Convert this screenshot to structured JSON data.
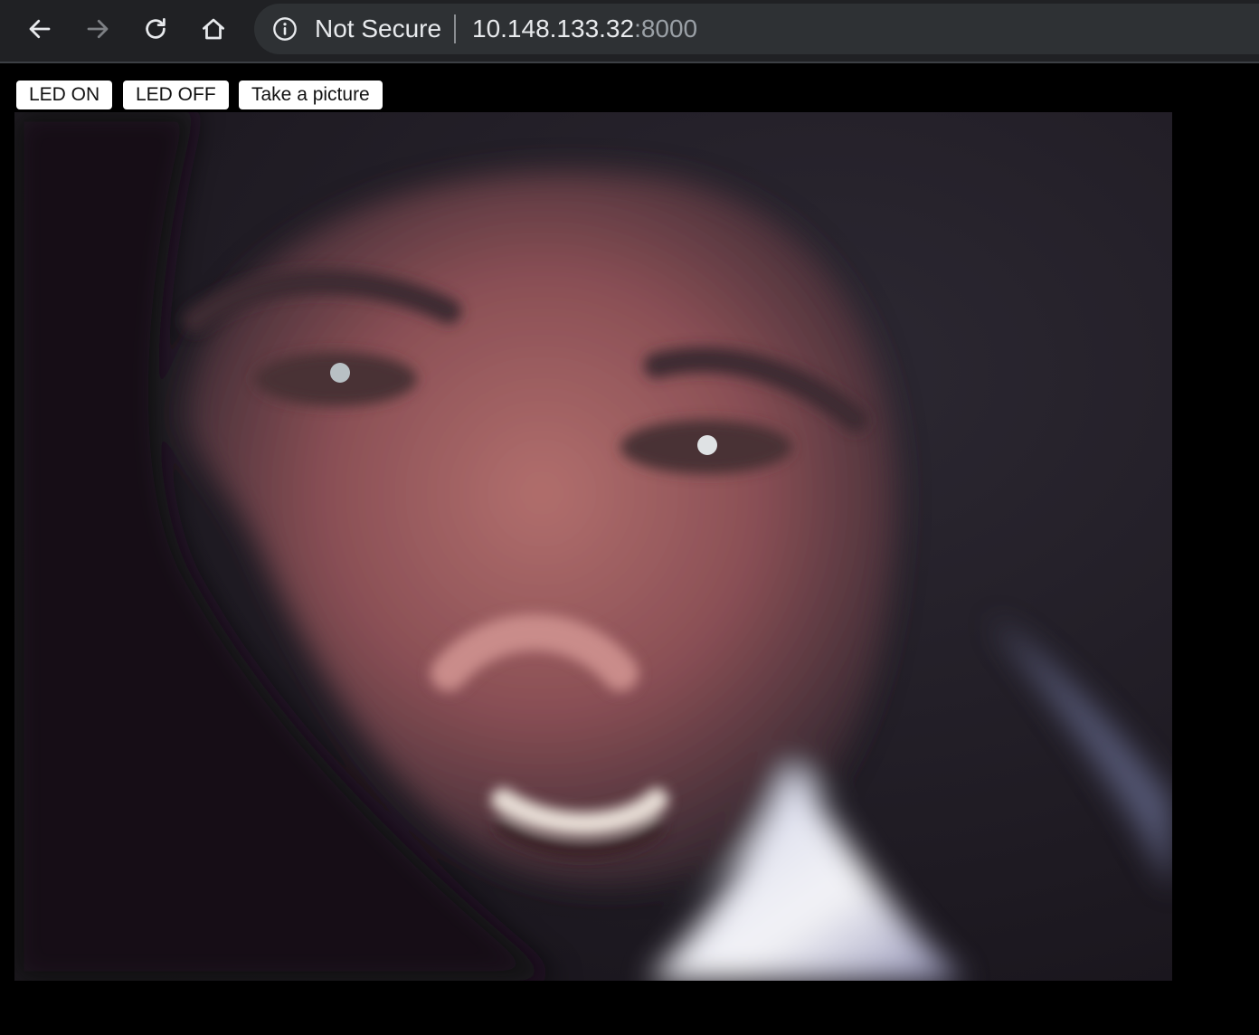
{
  "browser": {
    "back_icon": "arrow-left-icon",
    "forward_icon": "arrow-right-icon",
    "reload_icon": "reload-icon",
    "home_icon": "home-icon",
    "security_icon": "info-icon",
    "security_label": "Not Secure",
    "url_host": "10.148.133.32",
    "url_port": ":8000",
    "forward_enabled": false
  },
  "controls": {
    "led_on_label": "LED ON",
    "led_off_label": "LED OFF",
    "picture_label": "Take a picture"
  },
  "colors": {
    "toolbar_bg": "#202124",
    "omnibox_bg": "#2e3134",
    "page_bg": "#000000",
    "button_bg": "#ffffff"
  }
}
